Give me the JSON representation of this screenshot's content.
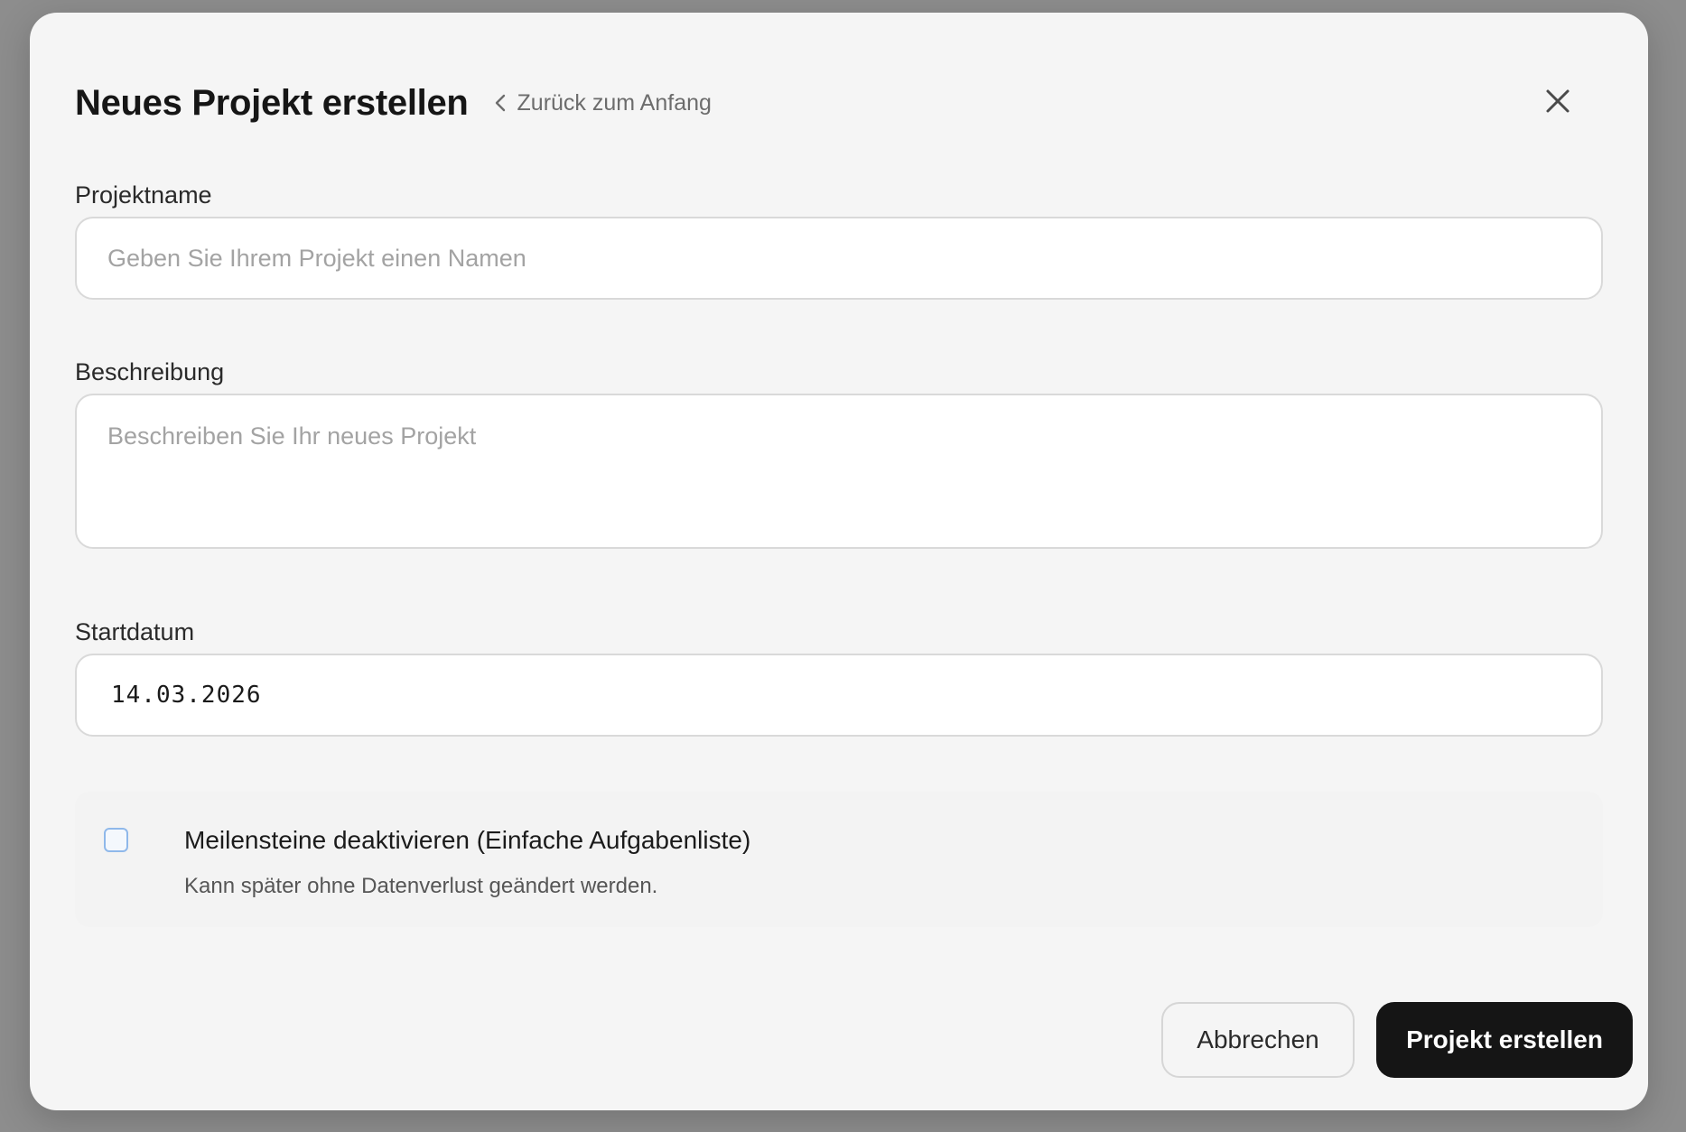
{
  "dialog": {
    "title": "Neues Projekt erstellen",
    "back_link": "Zurück zum Anfang"
  },
  "fields": {
    "name": {
      "label": "Projektname",
      "placeholder": "Geben Sie Ihrem Projekt einen Namen",
      "value": ""
    },
    "description": {
      "label": "Beschreibung",
      "placeholder": "Beschreiben Sie Ihr neues Projekt",
      "value": ""
    },
    "start_date": {
      "label": "Startdatum",
      "value": "14.03.2026"
    }
  },
  "option": {
    "label": "Meilensteine deaktivieren (Einfache Aufgabenliste)",
    "description": "Kann später ohne Datenverlust geändert werden.",
    "checked": false
  },
  "actions": {
    "cancel_label": "Abbrechen",
    "create_label": "Projekt erstellen"
  },
  "colors": {
    "backdrop": "#8d8d8d",
    "modal_bg": "#f5f5f5",
    "primary_button": "#151515",
    "checkbox_border": "#8fb8ea"
  },
  "icons": {
    "back": "chevron-left-icon",
    "close": "close-icon"
  }
}
